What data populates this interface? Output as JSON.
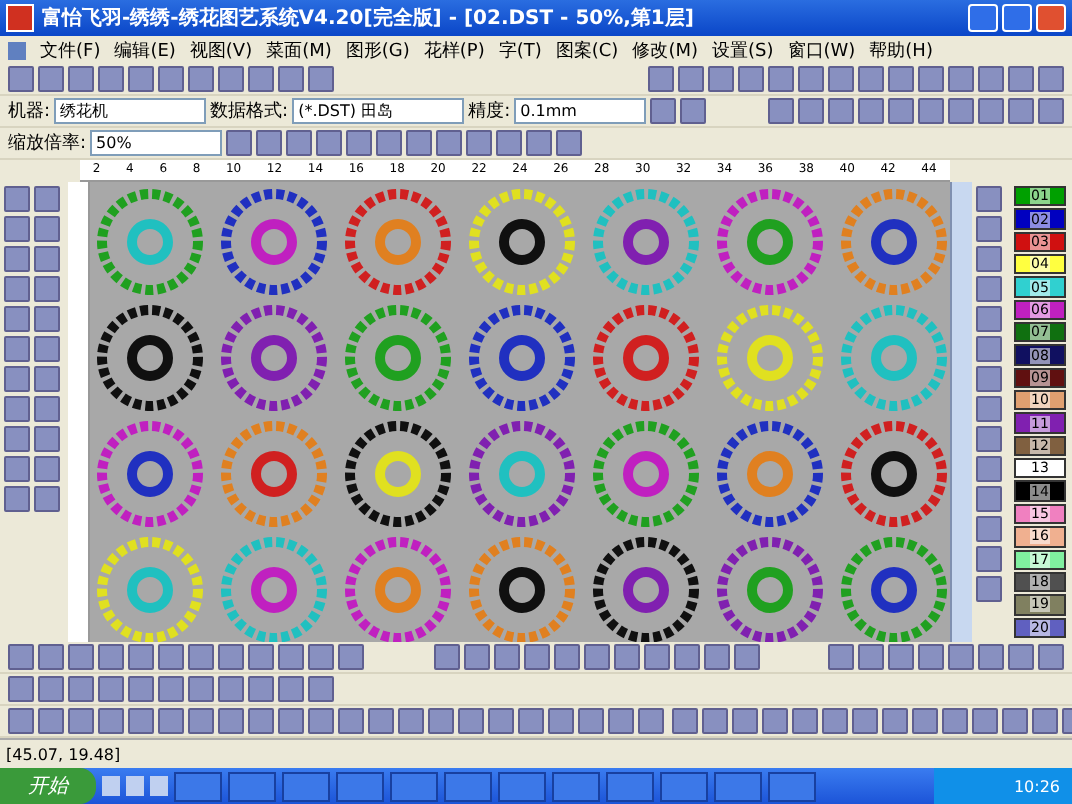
{
  "window": {
    "title": "富怡飞羽-绣绣-绣花图艺系统V4.20[完全版] - [02.DST - 50%,第1层]"
  },
  "menu": [
    "文件(F)",
    "编辑(E)",
    "视图(V)",
    "菜面(M)",
    "图形(G)",
    "花样(P)",
    "字(T)",
    "图案(C)",
    "修改(M)",
    "设置(S)",
    "窗口(W)",
    "帮助(H)"
  ],
  "machine_bar": {
    "machine_label": "机器:",
    "machine_value": "绣花机",
    "format_label": "数据格式:",
    "format_value": "(*.DST) 田岛",
    "precision_label": "精度:",
    "precision_value": "0.1mm"
  },
  "zoom_bar": {
    "label": "缩放倍率:",
    "value": "50%"
  },
  "ruler": [
    "2",
    "4",
    "6",
    "8",
    "10",
    "12",
    "14",
    "16",
    "18",
    "20",
    "22",
    "24",
    "26",
    "28",
    "30",
    "32",
    "34",
    "36",
    "38",
    "40",
    "42",
    "44"
  ],
  "palette": [
    {
      "label": "01",
      "color": "#00a000"
    },
    {
      "label": "02",
      "color": "#0000c0"
    },
    {
      "label": "03",
      "color": "#d01010"
    },
    {
      "label": "04",
      "color": "#ffff40"
    },
    {
      "label": "05",
      "color": "#30d0d0"
    },
    {
      "label": "06",
      "color": "#c020c0"
    },
    {
      "label": "07",
      "color": "#107010"
    },
    {
      "label": "08",
      "color": "#101060"
    },
    {
      "label": "09",
      "color": "#601010"
    },
    {
      "label": "10",
      "color": "#e0a070"
    },
    {
      "label": "11",
      "color": "#8020b0"
    },
    {
      "label": "12",
      "color": "#806040"
    },
    {
      "label": "13",
      "color": "#ffffff"
    },
    {
      "label": "14",
      "color": "#000000"
    },
    {
      "label": "15",
      "color": "#f080c0"
    },
    {
      "label": "16",
      "color": "#f0b090"
    },
    {
      "label": "17",
      "color": "#80f0a0"
    },
    {
      "label": "18",
      "color": "#505050"
    },
    {
      "label": "19",
      "color": "#808060"
    },
    {
      "label": "20",
      "color": "#6060c0"
    }
  ],
  "status_bar": {
    "coordinates": "[45.07, 19.48]"
  },
  "taskbar": {
    "start": "开始",
    "clock": "10:26"
  }
}
